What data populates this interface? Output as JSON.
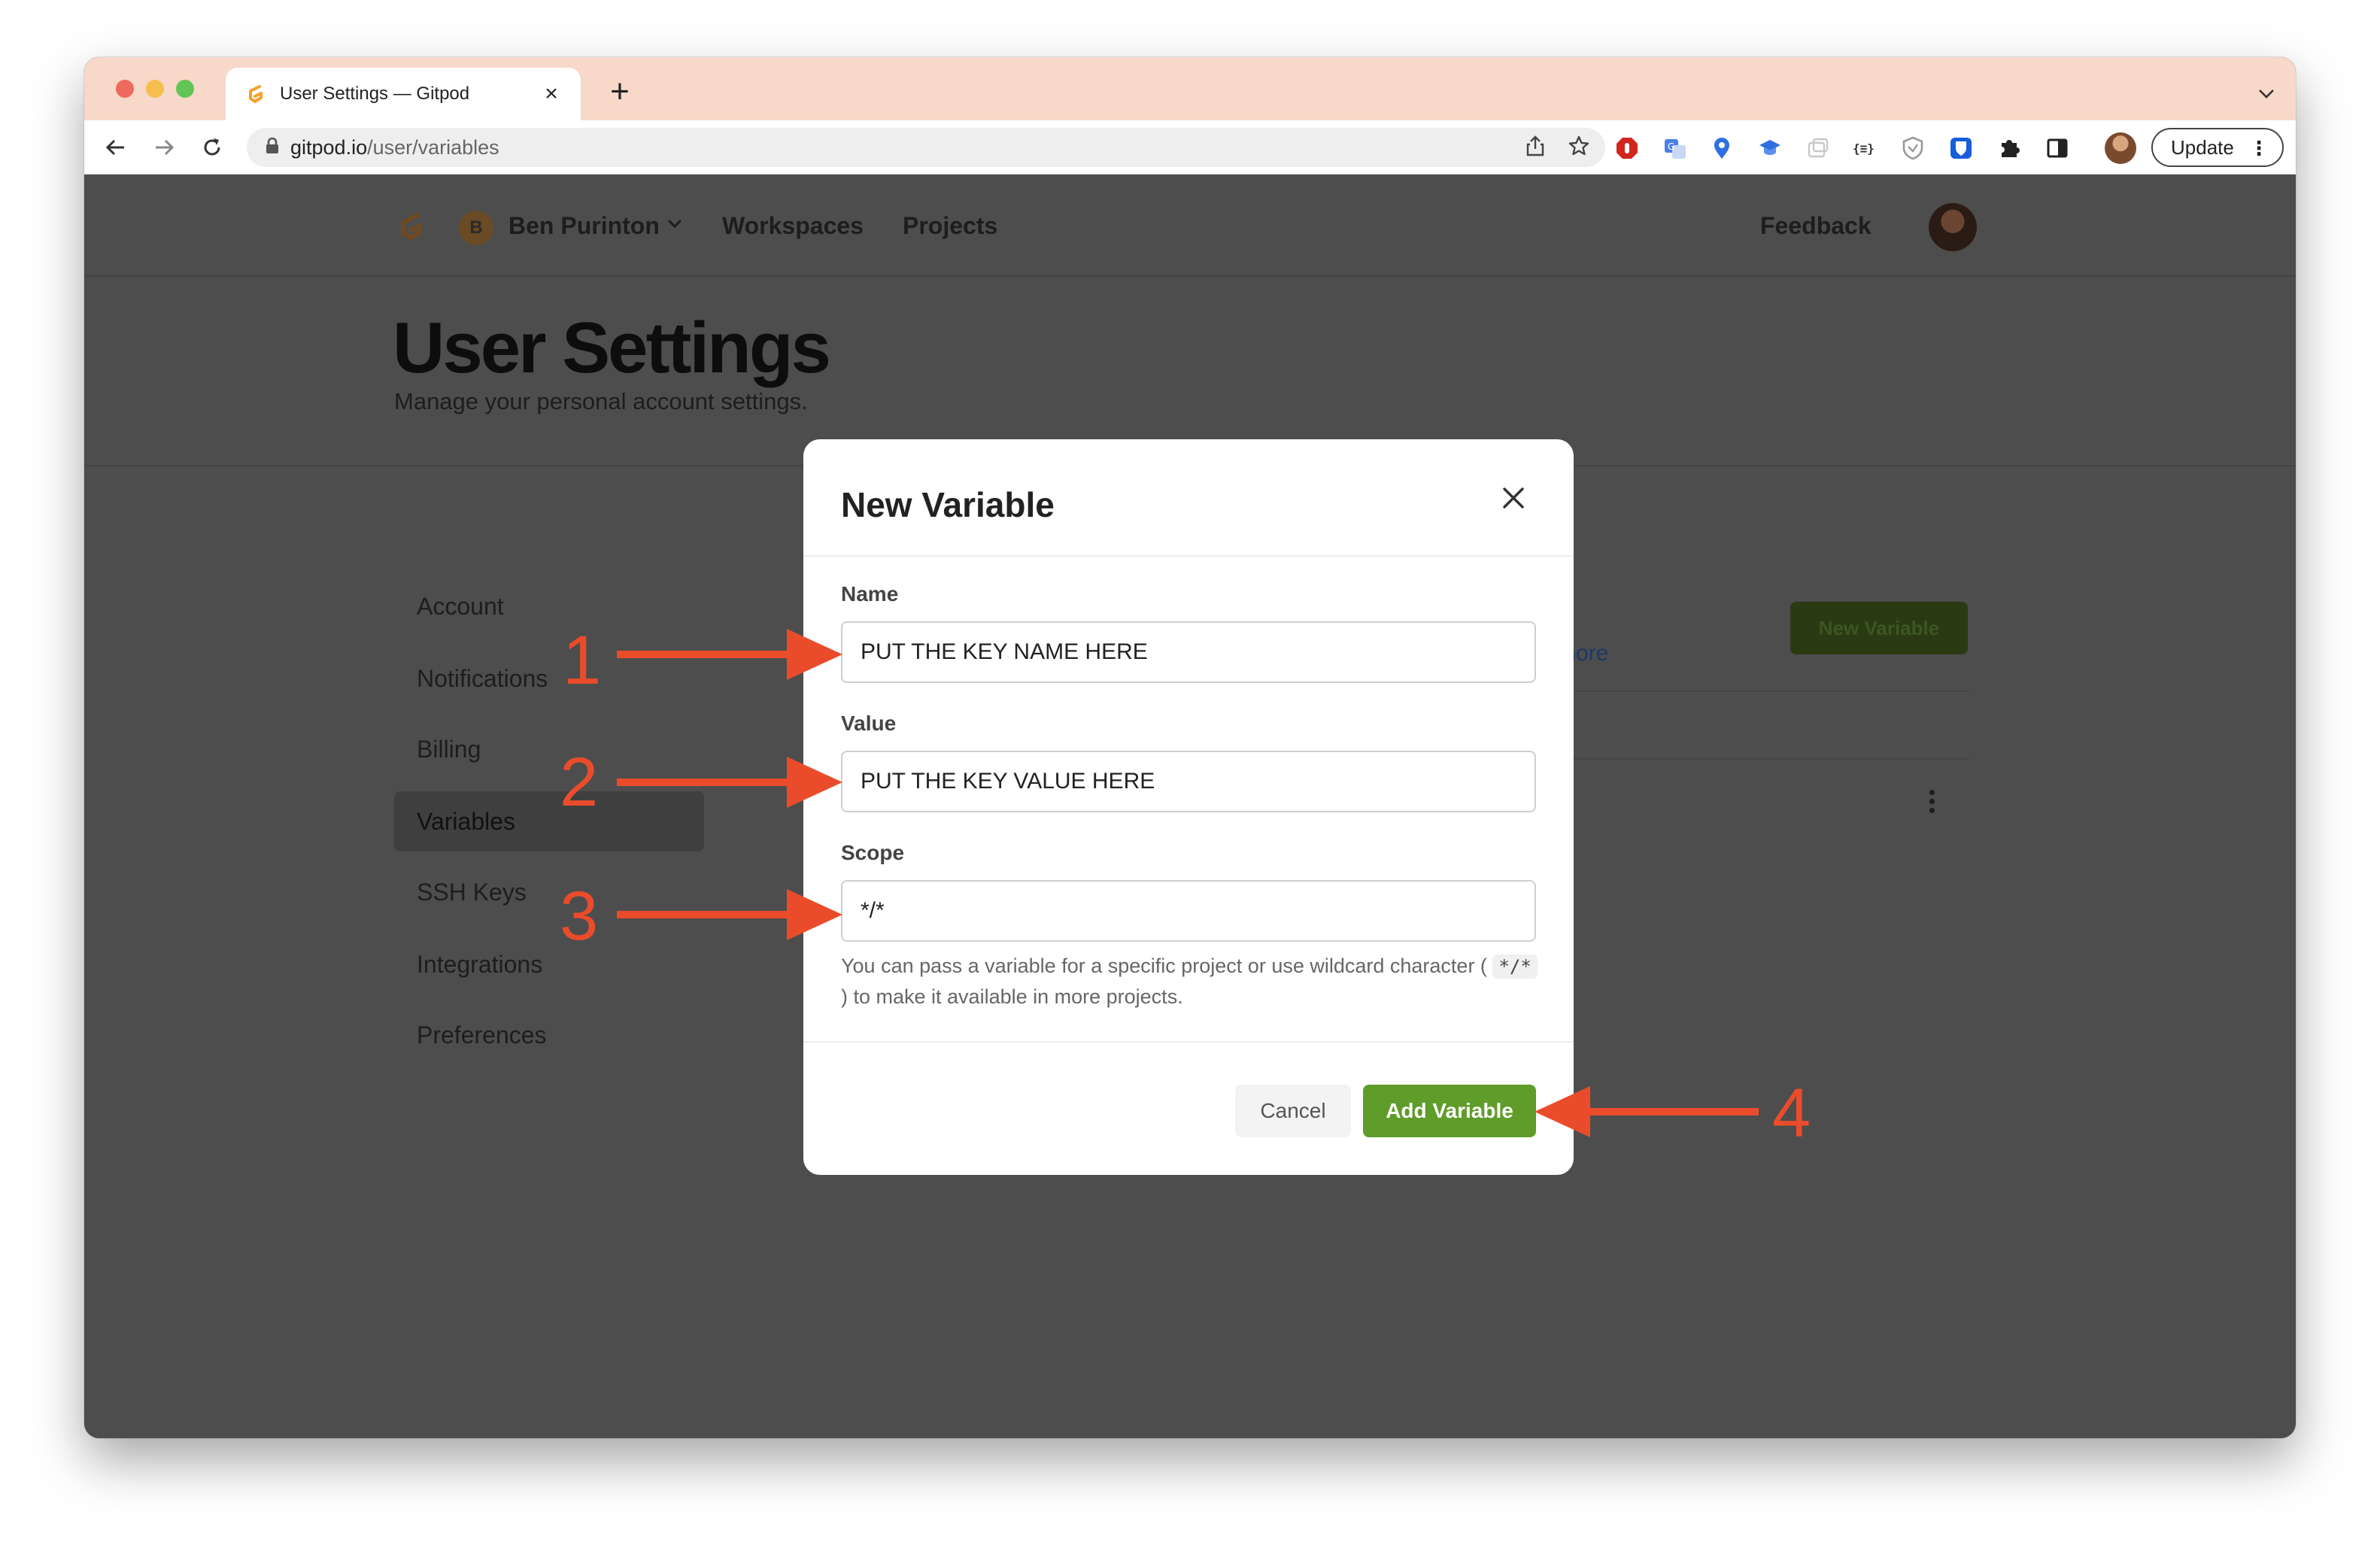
{
  "browser": {
    "tab_title": "User Settings — Gitpod",
    "tab_close": "×",
    "new_tab": "+",
    "url_host": "gitpod.io",
    "url_path": "/user/variables",
    "update_label": "Update",
    "update_menu": "⋮"
  },
  "nav": {
    "org_initial": "B",
    "org_name": "Ben Purinton",
    "workspaces": "Workspaces",
    "projects": "Projects",
    "feedback": "Feedback"
  },
  "header": {
    "title": "User Settings",
    "subtitle": "Manage your personal account settings."
  },
  "sidebar": {
    "items": [
      {
        "label": "Account"
      },
      {
        "label": "Notifications"
      },
      {
        "label": "Billing"
      },
      {
        "label": "Variables"
      },
      {
        "label": "SSH Keys"
      },
      {
        "label": "Integrations"
      },
      {
        "label": "Preferences"
      }
    ]
  },
  "background": {
    "new_variable": "New Variable",
    "learn_more_fragment": "more"
  },
  "modal": {
    "title": "New Variable",
    "name_label": "Name",
    "name_value": "PUT THE KEY NAME HERE",
    "value_label": "Value",
    "value_value": "PUT THE KEY VALUE HERE",
    "scope_label": "Scope",
    "scope_value": "*/*",
    "hint_before": "You can pass a variable for a specific project or use wildcard character (",
    "hint_code": "*/*",
    "hint_after": ") to make it available in more projects.",
    "cancel": "Cancel",
    "add": "Add Variable"
  },
  "annotations": [
    "1",
    "2",
    "3",
    "4"
  ],
  "colors": {
    "accent_green": "#5f9c2a",
    "annotation_red": "#ea4c2b",
    "overlay": "#4d4d4d",
    "titlebar": "#f7d8c9"
  }
}
